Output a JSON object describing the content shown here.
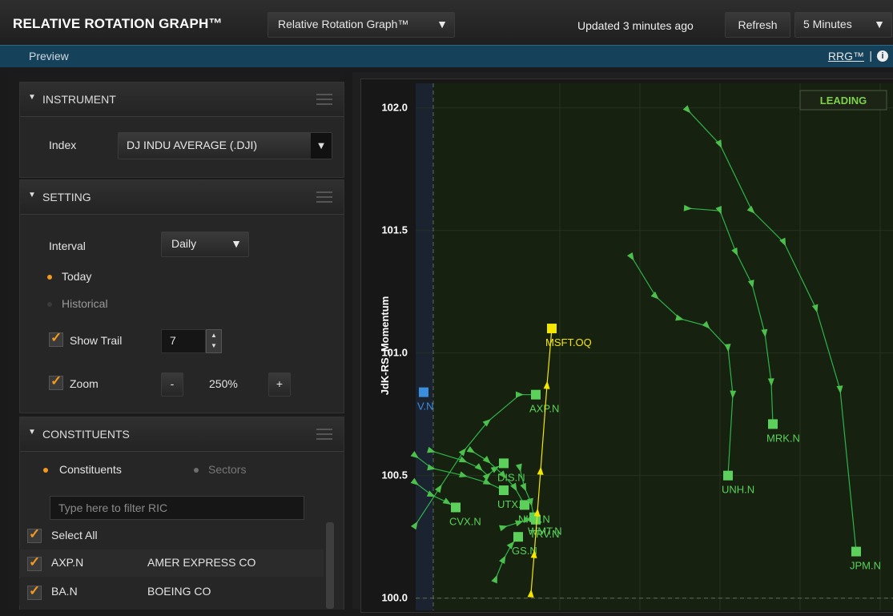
{
  "header": {
    "title": "RELATIVE ROTATION GRAPH™",
    "view_select": "Relative Rotation Graph™",
    "updated": "Updated 3 minutes ago",
    "refresh": "Refresh",
    "interval_select": "5 Minutes"
  },
  "subbar": {
    "preview": "Preview",
    "link": "RRG™",
    "separator": "|",
    "info_icon": "info-icon"
  },
  "instrument": {
    "title": "INSTRUMENT",
    "index_label": "Index",
    "index_value": "DJ INDU AVERAGE (.DJI)"
  },
  "setting": {
    "title": "SETTING",
    "interval_label": "Interval",
    "interval_value": "Daily",
    "today": "Today",
    "historical": "Historical",
    "show_trail": "Show Trail",
    "trail_value": "7",
    "zoom": "Zoom",
    "zoom_minus": "-",
    "zoom_value": "250%",
    "zoom_plus": "+"
  },
  "constituents": {
    "title": "CONSTITUENTS",
    "tab_constituents": "Constituents",
    "tab_sectors": "Sectors",
    "filter_placeholder": "Type here to filter RIC",
    "select_all": "Select All",
    "rows": [
      {
        "ric": "AXP.N",
        "name": "AMER EXPRESS CO"
      },
      {
        "ric": "BA.N",
        "name": "BOEING CO"
      }
    ]
  },
  "colors": {
    "accent_orange": "#f39a1e",
    "trail_green": "#2fb34a",
    "marker_green": "#5bd05b",
    "highlight_yellow": "#f5e600",
    "marker_blue": "#3a8ede",
    "subbar_blue": "#15425a"
  },
  "chart_data": {
    "type": "scatter",
    "ylabel": "JdK-RS_Momentum",
    "quadrant_label": "LEADING",
    "yticks": [
      "102.0",
      "101.5",
      "101.0",
      "100.5",
      "100.0"
    ],
    "ylim": [
      99.95,
      102.1
    ],
    "xlim": [
      99.6,
      102.6
    ],
    "series": [
      {
        "name": "JPM.N",
        "color": "#5bd05b",
        "x": [
          101.3,
          101.5,
          101.7,
          101.9,
          102.1,
          102.25,
          102.35
        ],
        "y": [
          101.99,
          101.85,
          101.58,
          101.45,
          101.18,
          100.85,
          100.19
        ]
      },
      {
        "name": "MRK.N",
        "color": "#5bd05b",
        "x": [
          101.3,
          101.5,
          101.6,
          101.7,
          101.78,
          101.82,
          101.83
        ],
        "y": [
          101.59,
          101.58,
          101.41,
          101.28,
          101.08,
          100.88,
          100.71
        ]
      },
      {
        "name": "UNH.N",
        "color": "#5bd05b",
        "x": [
          100.95,
          101.1,
          101.25,
          101.42,
          101.55,
          101.58,
          101.55
        ],
        "y": [
          101.39,
          101.23,
          101.14,
          101.11,
          101.02,
          100.83,
          100.5
        ]
      },
      {
        "name": "AXP.N",
        "color": "#5bd05b",
        "x": [
          99.6,
          99.75,
          99.9,
          100.05,
          100.25,
          100.35
        ],
        "y": [
          100.3,
          100.45,
          100.6,
          100.72,
          100.83,
          100.83
        ]
      },
      {
        "name": "DIS.N",
        "color": "#5bd05b",
        "x": [
          99.7,
          99.9,
          100.0,
          100.05,
          100.1,
          100.15
        ],
        "y": [
          100.6,
          100.56,
          100.53,
          100.5,
          100.53,
          100.55
        ]
      },
      {
        "name": "UTX.N",
        "color": "#5bd05b",
        "x": [
          99.6,
          99.7,
          99.9,
          100.05,
          100.15
        ],
        "y": [
          100.58,
          100.53,
          100.5,
          100.47,
          100.44
        ]
      },
      {
        "name": "NKE.N",
        "color": "#5bd05b",
        "x": [
          99.95,
          100.05,
          100.15,
          100.22,
          100.28
        ],
        "y": [
          100.6,
          100.56,
          100.5,
          100.45,
          100.38
        ]
      },
      {
        "name": "CVX.N",
        "color": "#5bd05b",
        "x": [
          99.6,
          99.7,
          99.8,
          99.85
        ],
        "y": [
          100.47,
          100.42,
          100.39,
          100.37
        ]
      },
      {
        "name": "TRV.N",
        "color": "#5bd05b",
        "x": [
          100.15,
          100.25,
          100.3,
          100.35
        ],
        "y": [
          100.29,
          100.31,
          100.32,
          100.32
        ]
      },
      {
        "name": "WMT.N",
        "color": "#5bd05b",
        "x": [
          100.25,
          100.28,
          100.32,
          100.34
        ],
        "y": [
          100.53,
          100.45,
          100.39,
          100.33
        ]
      },
      {
        "name": "GS.N",
        "color": "#5bd05b",
        "x": [
          100.1,
          100.15,
          100.2,
          100.24
        ],
        "y": [
          100.08,
          100.16,
          100.22,
          100.25
        ]
      },
      {
        "name": "MSFT.OQ",
        "color": "#f5e600",
        "x": [
          100.32,
          100.34,
          100.36,
          100.38,
          100.42,
          100.45
        ],
        "y": [
          100.02,
          100.18,
          100.35,
          100.52,
          100.87,
          101.1
        ]
      },
      {
        "name": "V.N",
        "color": "#3a8ede",
        "x": [
          99.65
        ],
        "y": [
          100.84
        ]
      }
    ]
  }
}
